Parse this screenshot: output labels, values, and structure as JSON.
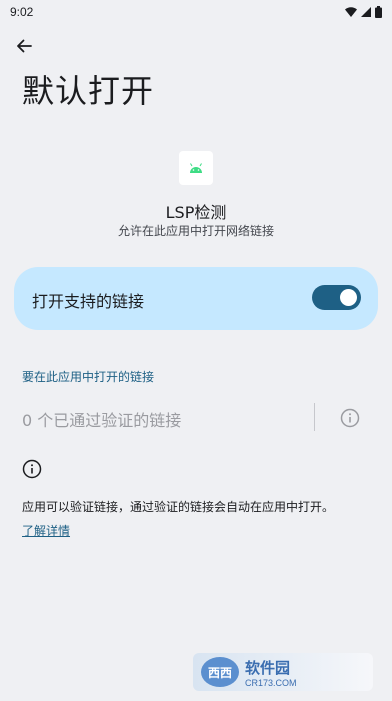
{
  "status_bar": {
    "time": "9:02"
  },
  "header": {
    "title": "默认打开"
  },
  "app": {
    "name": "LSP检测",
    "subtitle": "允许在此应用中打开网络链接"
  },
  "toggle": {
    "label": "打开支持的链接",
    "enabled": true
  },
  "links_section": {
    "header": "要在此应用中打开的链接",
    "verified_text": "0 个已通过验证的链接"
  },
  "footer": {
    "description": "应用可以验证链接，通过验证的链接会自动在应用中打开。",
    "learn_more": "了解详情"
  },
  "watermark": {
    "brand": "西西",
    "tag": "软件园",
    "site": "CR173.COM"
  },
  "colors": {
    "background": "#eff0f3",
    "card": "#c5e8ff",
    "accent": "#1e6085",
    "android_green": "#3ddc84"
  },
  "icons": [
    "back-arrow-icon",
    "wifi-icon",
    "signal-icon",
    "battery-icon",
    "android-icon",
    "info-icon"
  ]
}
